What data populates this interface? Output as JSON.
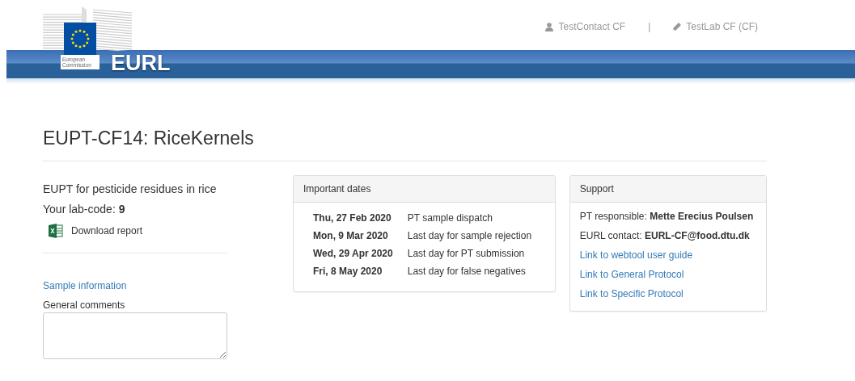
{
  "header": {
    "logo_caption": "European Commission",
    "logo_text": "EURL",
    "user": "TestContact CF",
    "separator": "|",
    "lab": "TestLab CF (CF)"
  },
  "title": "EUPT-CF14: RiceKernels",
  "left": {
    "subtitle": "EUPT for pesticide residues in rice",
    "lab_code_label": "Your lab-code:",
    "lab_code": "9",
    "download": "Download report",
    "sample_link": "Sample information",
    "comments_label": "General comments"
  },
  "dates_panel": {
    "title": "Important dates",
    "rows": [
      {
        "date": "Thu, 27 Feb 2020",
        "event": "PT sample dispatch"
      },
      {
        "date": "Mon, 9 Mar 2020",
        "event": "Last day for sample rejection"
      },
      {
        "date": "Wed, 29 Apr 2020",
        "event": "Last day for PT submission"
      },
      {
        "date": "Fri, 8 May 2020",
        "event": "Last day for false negatives"
      }
    ]
  },
  "support_panel": {
    "title": "Support",
    "lines": [
      {
        "kind": "text",
        "text": "PT responsible: **Mette Erecius Poulsen**"
      },
      {
        "kind": "text",
        "text": "EURL contact: **EURL-CF@food.dtu.dk**"
      },
      {
        "kind": "link",
        "text": "Link to webtool user guide"
      },
      {
        "kind": "link",
        "text": "Link to General Protocol"
      },
      {
        "kind": "link",
        "text": "Link to Specific Protocol"
      }
    ]
  }
}
